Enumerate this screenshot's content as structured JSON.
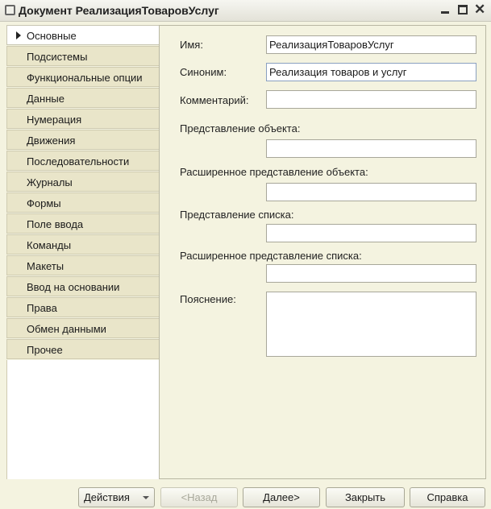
{
  "window": {
    "title": "Документ РеализацияТоваровУслуг",
    "icon": "document-icon",
    "controls": [
      "minimize-icon",
      "maximize-icon",
      "close-icon"
    ]
  },
  "nav": {
    "items": [
      {
        "label": "Основные",
        "active": true
      },
      {
        "label": "Подсистемы"
      },
      {
        "label": "Функциональные опции"
      },
      {
        "label": "Данные"
      },
      {
        "label": "Нумерация"
      },
      {
        "label": "Движения"
      },
      {
        "label": "Последовательности"
      },
      {
        "label": "Журналы"
      },
      {
        "label": "Формы"
      },
      {
        "label": "Поле ввода"
      },
      {
        "label": "Команды"
      },
      {
        "label": "Макеты"
      },
      {
        "label": "Ввод на основании"
      },
      {
        "label": "Права"
      },
      {
        "label": "Обмен данными"
      },
      {
        "label": "Прочее"
      }
    ]
  },
  "form": {
    "name_label": "Имя:",
    "name_value": "РеализацияТоваровУслуг",
    "synonym_label": "Синоним:",
    "synonym_value": "Реализация товаров и услуг",
    "comment_label": "Комментарий:",
    "comment_value": "",
    "object_repr_label": "Представление объекта:",
    "object_repr_value": "",
    "ext_object_repr_label": "Расширенное представление объекта:",
    "ext_object_repr_value": "",
    "list_repr_label": "Представление списка:",
    "list_repr_value": "",
    "ext_list_repr_label": "Расширенное представление списка:",
    "ext_list_repr_value": "",
    "explanation_label": "Пояснение:",
    "explanation_value": ""
  },
  "buttons": {
    "actions": "Действия",
    "back": "<Назад",
    "next": "Далее>",
    "close": "Закрыть",
    "help": "Справка"
  }
}
